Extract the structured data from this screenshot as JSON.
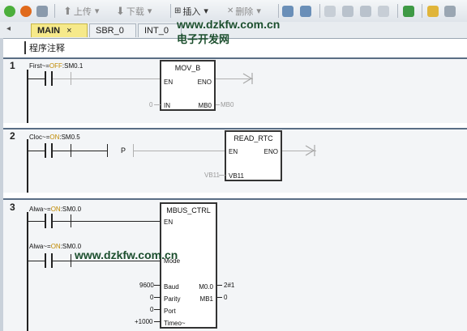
{
  "toolbar": {
    "upload_label": "上传",
    "download_label": "下载",
    "insert_label": "插入",
    "delete_label": "删除"
  },
  "tabs": [
    {
      "label": "MAIN",
      "close": "×"
    },
    {
      "label": "SBR_0"
    },
    {
      "label": "INT_0"
    }
  ],
  "watermarks": {
    "top": "www.dzkfw.com.cn",
    "top_sub": "电子开发网",
    "middle": "www.dzkfw.com.cn"
  },
  "program_comment": "程序注释",
  "networks": [
    {
      "number": "1",
      "contact": {
        "symbol": "First~",
        "state": "OFF",
        "addr": "SM0.1"
      },
      "box": {
        "title": "MOV_B",
        "en": "EN",
        "eno": "ENO",
        "in_pin": "IN",
        "out_pin": "MB0",
        "in_val": "0",
        "out_val": "MB0"
      }
    },
    {
      "number": "2",
      "contact": {
        "symbol": "Cloc~",
        "state": "ON",
        "addr": "SM0.5"
      },
      "pulse": "P",
      "box": {
        "title": "READ_RTC",
        "en": "EN",
        "eno": "ENO",
        "t_pin": "VB11",
        "t_val": "VB11"
      }
    },
    {
      "number": "3",
      "contact1": {
        "symbol": "Alwa~",
        "state": "ON",
        "addr": "SM0.0"
      },
      "contact2": {
        "symbol": "Alwa~",
        "state": "ON",
        "addr": "SM0.0"
      },
      "box": {
        "title": "MBUS_CTRL",
        "en": "EN",
        "mode": "Mode",
        "baud": "Baud",
        "baud_val": "9600",
        "parity": "Parity",
        "parity_val": "0",
        "port": "Port",
        "port_val": "0",
        "timeout": "Timeo~",
        "timeout_val": "+1000",
        "done": "M0.0",
        "done_val": "2#1",
        "error": "MB1",
        "error_val": "0"
      }
    }
  ]
}
